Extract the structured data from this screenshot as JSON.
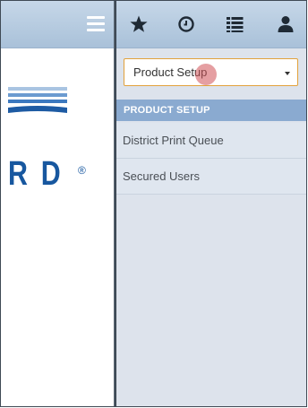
{
  "logo": {
    "text": "R D",
    "registered": "®"
  },
  "toolbar": {
    "icons": [
      "hamburger-icon",
      "star-icon",
      "clock-icon",
      "list-icon",
      "user-icon"
    ]
  },
  "product_select": {
    "value": "Product Setup"
  },
  "menu": {
    "section_title": "PRODUCT SETUP",
    "items": [
      {
        "label": "District Print Queue"
      },
      {
        "label": "Secured Users"
      }
    ]
  },
  "colors": {
    "header_gradient_top": "#c6d7e8",
    "header_gradient_bottom": "#a9c1d9",
    "section_header": "#8aaad0",
    "select_border": "#e2a13b",
    "logo_blue": "#17579f",
    "pane_bg": "#dde3ec"
  }
}
